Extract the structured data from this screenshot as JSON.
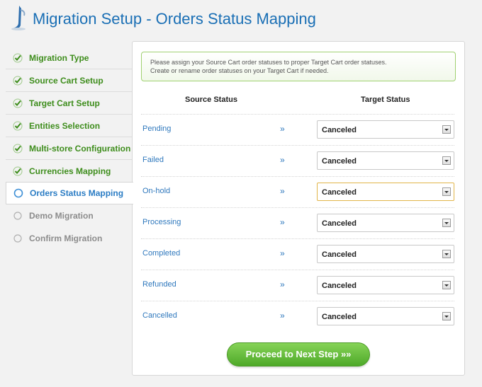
{
  "title": "Migration Setup - Orders Status Mapping",
  "colors": {
    "accent_blue": "#1a6fb5",
    "done_green": "#3e8d1c",
    "pending_gray": "#8c8c8c",
    "button_green": "#5fb833"
  },
  "sidebar": {
    "items": [
      {
        "label": "Migration Type",
        "state": "done",
        "icon": "check-icon"
      },
      {
        "label": "Source Cart Setup",
        "state": "done",
        "icon": "check-icon"
      },
      {
        "label": "Target Cart Setup",
        "state": "done",
        "icon": "check-icon"
      },
      {
        "label": "Entities Selection",
        "state": "done",
        "icon": "check-icon"
      },
      {
        "label": "Multi-store Configuration",
        "state": "done",
        "icon": "check-icon"
      },
      {
        "label": "Currencies Mapping",
        "state": "done",
        "icon": "check-icon"
      },
      {
        "label": "Orders Status Mapping",
        "state": "active",
        "icon": "current-step-icon"
      },
      {
        "label": "Demo Migration",
        "state": "pending",
        "icon": "empty-circle-icon"
      },
      {
        "label": "Confirm Migration",
        "state": "pending",
        "icon": "empty-circle-icon"
      }
    ]
  },
  "notice": {
    "line1": "Please assign your Source Cart order statuses to proper Target Cart order statuses.",
    "line2": "Create or rename order statuses on your Target Cart if needed."
  },
  "columns": {
    "source": "Source Status",
    "target": "Target Status"
  },
  "mappings": [
    {
      "source": "Pending",
      "arrow": "»",
      "target": "Canceled"
    },
    {
      "source": "Failed",
      "arrow": "»",
      "target": "Canceled"
    },
    {
      "source": "On-hold",
      "arrow": "»",
      "target": "Canceled"
    },
    {
      "source": "Processing",
      "arrow": "»",
      "target": "Canceled"
    },
    {
      "source": "Completed",
      "arrow": "»",
      "target": "Canceled"
    },
    {
      "source": "Refunded",
      "arrow": "»",
      "target": "Canceled"
    },
    {
      "source": "Cancelled",
      "arrow": "»",
      "target": "Canceled"
    }
  ],
  "proceed_label": "Proceed to Next Step »»"
}
